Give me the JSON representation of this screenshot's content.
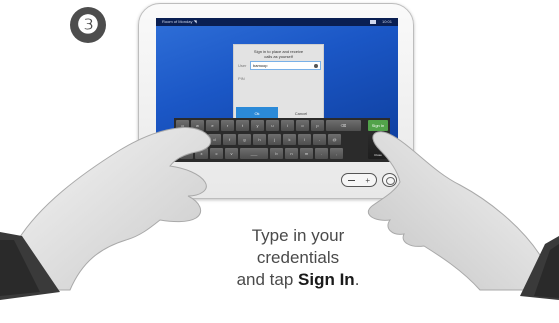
{
  "step_number": "❸",
  "device": {
    "status_left": "Room of Monday ◥",
    "status_right": "10:01"
  },
  "dialog": {
    "title_line1": "Sign in to place and receive",
    "title_line2": "calls as yourself",
    "user_label": "User",
    "user_value": "bamoop",
    "pin_label": "PIN",
    "ok_label": "Ok",
    "cancel_label": "Cancel"
  },
  "keyboard": {
    "row1": [
      "q",
      "w",
      "e",
      "r",
      "t",
      "y",
      "u",
      "i",
      "o",
      "p",
      "⌫"
    ],
    "row2": [
      "a",
      "s",
      "d",
      "f",
      "g",
      "h",
      "j",
      "k",
      "l",
      "-",
      "@"
    ],
    "row3": [
      "z",
      "x",
      "c",
      "v",
      "___",
      "b",
      "n",
      "m",
      ".",
      ","
    ],
    "signin_key": "Sign In",
    "close_key": "✖",
    "close_label": "Close"
  },
  "caption": {
    "line1": "Type in your",
    "line2": "credentials",
    "line3_pre": "and tap ",
    "line3_bold": "Sign In",
    "line3_post": "."
  }
}
